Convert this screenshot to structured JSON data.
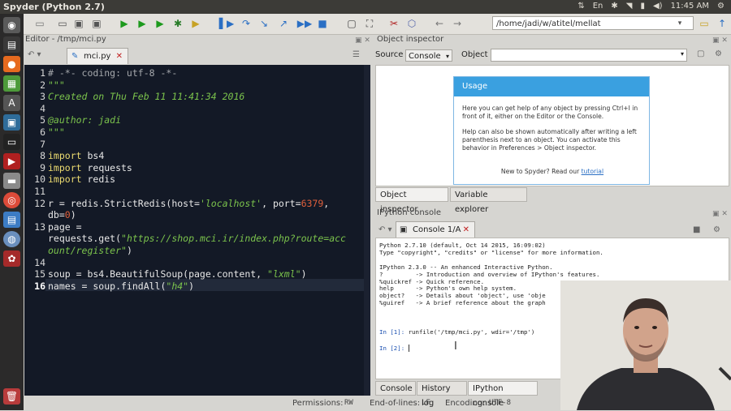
{
  "system": {
    "window_title": "Spyder (Python 2.7)",
    "keyboard": "En",
    "clock": "11:45 AM"
  },
  "toolbar": {
    "path": "/home/jadi/w/atitel/mellat"
  },
  "editor": {
    "title": "Editor - /tmp/mci.py",
    "tab_label": "mci.py",
    "lines": [
      {
        "n": "1",
        "segs": [
          {
            "t": "# -*- coding: utf-8 -*-",
            "c": "cm"
          }
        ]
      },
      {
        "n": "2",
        "segs": [
          {
            "t": "\"\"\"",
            "c": "it"
          }
        ]
      },
      {
        "n": "3",
        "segs": [
          {
            "t": "Created on Thu Feb 11 11:41:34 2016",
            "c": "it"
          }
        ]
      },
      {
        "n": "4",
        "segs": []
      },
      {
        "n": "5",
        "segs": [
          {
            "t": "@author: jadi",
            "c": "it"
          }
        ]
      },
      {
        "n": "6",
        "segs": [
          {
            "t": "\"\"\"",
            "c": "it"
          }
        ]
      },
      {
        "n": "7",
        "segs": []
      },
      {
        "n": "8",
        "segs": [
          {
            "t": "import",
            "c": "kw"
          },
          {
            "t": " bs4",
            "c": ""
          }
        ]
      },
      {
        "n": "9",
        "segs": [
          {
            "t": "import",
            "c": "kw"
          },
          {
            "t": " requests",
            "c": ""
          }
        ]
      },
      {
        "n": "10",
        "segs": [
          {
            "t": "import",
            "c": "kw"
          },
          {
            "t": " redis",
            "c": ""
          }
        ]
      },
      {
        "n": "11",
        "segs": []
      },
      {
        "n": "12",
        "segs": [
          {
            "t": "r = redis.StrictRedis(host=",
            "c": ""
          },
          {
            "t": "'localhost'",
            "c": "st"
          },
          {
            "t": ", port=",
            "c": ""
          },
          {
            "t": "6379",
            "c": "nm"
          },
          {
            "t": ",",
            "c": ""
          }
        ]
      },
      {
        "n": "",
        "segs": [
          {
            "t": "db=",
            "c": ""
          },
          {
            "t": "0",
            "c": "nm"
          },
          {
            "t": ")",
            "c": ""
          }
        ]
      },
      {
        "n": "13",
        "segs": [
          {
            "t": "page =",
            "c": ""
          }
        ]
      },
      {
        "n": "",
        "segs": [
          {
            "t": "requests.get(",
            "c": ""
          },
          {
            "t": "\"https://shop.mci.ir/index.php?route=acc",
            "c": "st"
          }
        ]
      },
      {
        "n": "",
        "segs": [
          {
            "t": "ount/register\"",
            "c": "st"
          },
          {
            "t": ")",
            "c": ""
          }
        ]
      },
      {
        "n": "14",
        "segs": []
      },
      {
        "n": "15",
        "segs": [
          {
            "t": "soup = bs4.BeautifulSoup(page.content, ",
            "c": ""
          },
          {
            "t": "\"lxml\"",
            "c": "st"
          },
          {
            "t": ")",
            "c": ""
          }
        ]
      },
      {
        "n": "16",
        "segs": [
          {
            "t": "names = soup.findAll(",
            "c": ""
          },
          {
            "t": "\"h4\"",
            "c": "st"
          },
          {
            "t": ")",
            "c": ""
          }
        ]
      }
    ]
  },
  "status": {
    "permissions_label": "Permissions:",
    "permissions_value": "RW",
    "eol_label": "End-of-lines:",
    "eol_value": "LF",
    "encoding_label": "Encoding:",
    "encoding_value": "UTF-8"
  },
  "object_inspector": {
    "title": "Object inspector",
    "source_label": "Source",
    "source_value": "Console",
    "object_label": "Object",
    "usage_header": "Usage",
    "usage_p1": "Here you can get help of any object by pressing Ctrl+I in front of it, either on the Editor or the Console.",
    "usage_p2": "Help can also be shown automatically after writing a left parenthesis next to an object. You can activate this behavior in Preferences > Object inspector.",
    "usage_new": "New to Spyder? Read our",
    "usage_link": "tutorial",
    "tabs": [
      "Object inspector",
      "Variable explorer"
    ]
  },
  "ipython": {
    "title": "IPython console",
    "tab_label": "Console 1/A",
    "lines": [
      "Python 2.7.10 (default, Oct 14 2015, 16:09:02)",
      "Type \"copyright\", \"credits\" or \"license\" for more information.",
      "",
      "IPython 2.3.0 -- An enhanced Interactive Python.",
      "?         -> Introduction and overview of IPython's features.",
      "%quickref -> Quick reference.",
      "help      -> Python's own help system.",
      "object?   -> Details about 'object', use 'obje",
      "%guiref   -> A brief reference about the graph"
    ],
    "in1_prompt": "In [1]:",
    "in1_cmd": "runfile('/tmp/mci.py', wdir='/tmp')",
    "in2_prompt": "In [2]:",
    "bottom_tabs": [
      "Console",
      "History log",
      "IPython console"
    ]
  }
}
